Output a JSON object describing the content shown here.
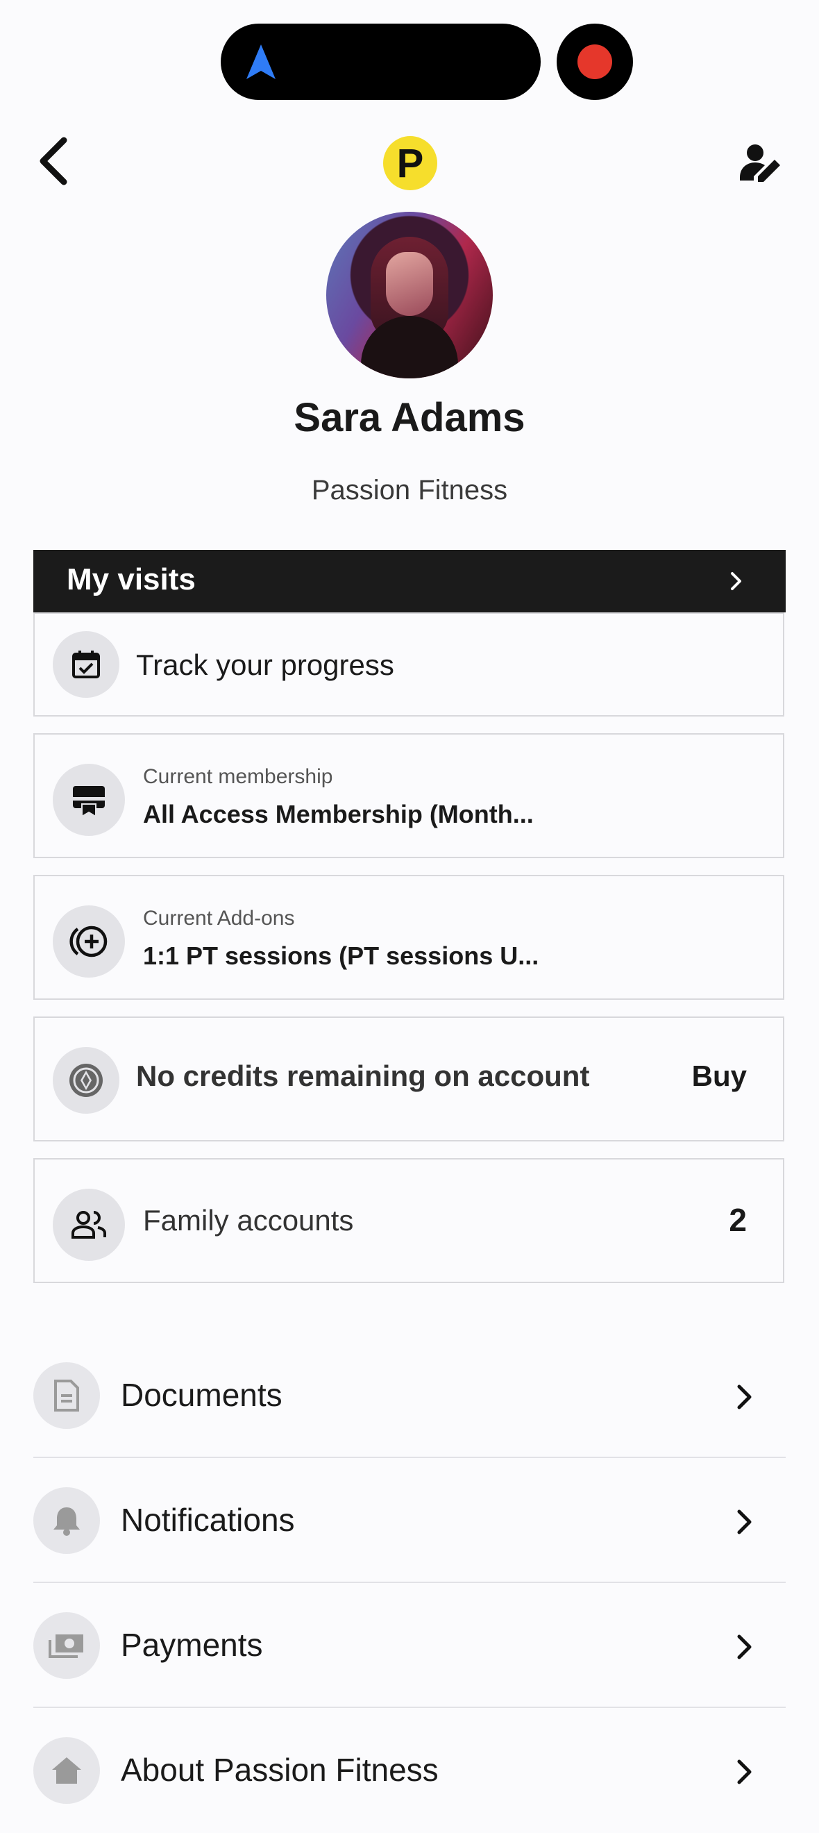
{
  "header": {
    "logo_letter": "P"
  },
  "profile": {
    "name": "Sara Adams",
    "gym": "Passion Fitness"
  },
  "visits": {
    "label": "My visits"
  },
  "cards": {
    "progress": {
      "title": "Track your progress",
      "icon": "calendar-check-icon"
    },
    "membership": {
      "sub": "Current membership",
      "value": "All Access Membership (Month...",
      "icon": "membership-card-icon"
    },
    "addons": {
      "sub": "Current Add-ons",
      "value": "1:1 PT sessions (PT sessions U...",
      "icon": "add-circle-icon"
    },
    "credits": {
      "title": "No credits remaining on account",
      "action": "Buy",
      "icon": "credits-coin-icon"
    },
    "family": {
      "title": "Family accounts",
      "count": "2",
      "icon": "people-icon"
    }
  },
  "menu": [
    {
      "label": "Documents",
      "icon": "document-icon"
    },
    {
      "label": "Notifications",
      "icon": "bell-icon"
    },
    {
      "label": "Payments",
      "icon": "money-icon"
    },
    {
      "label": "About Passion Fitness",
      "icon": "home-icon"
    }
  ],
  "colors": {
    "logo": "#f6de2c",
    "record": "#e5372b",
    "nav_arrow": "#2f7cf6",
    "visits_bar": "#1b1b1b"
  }
}
